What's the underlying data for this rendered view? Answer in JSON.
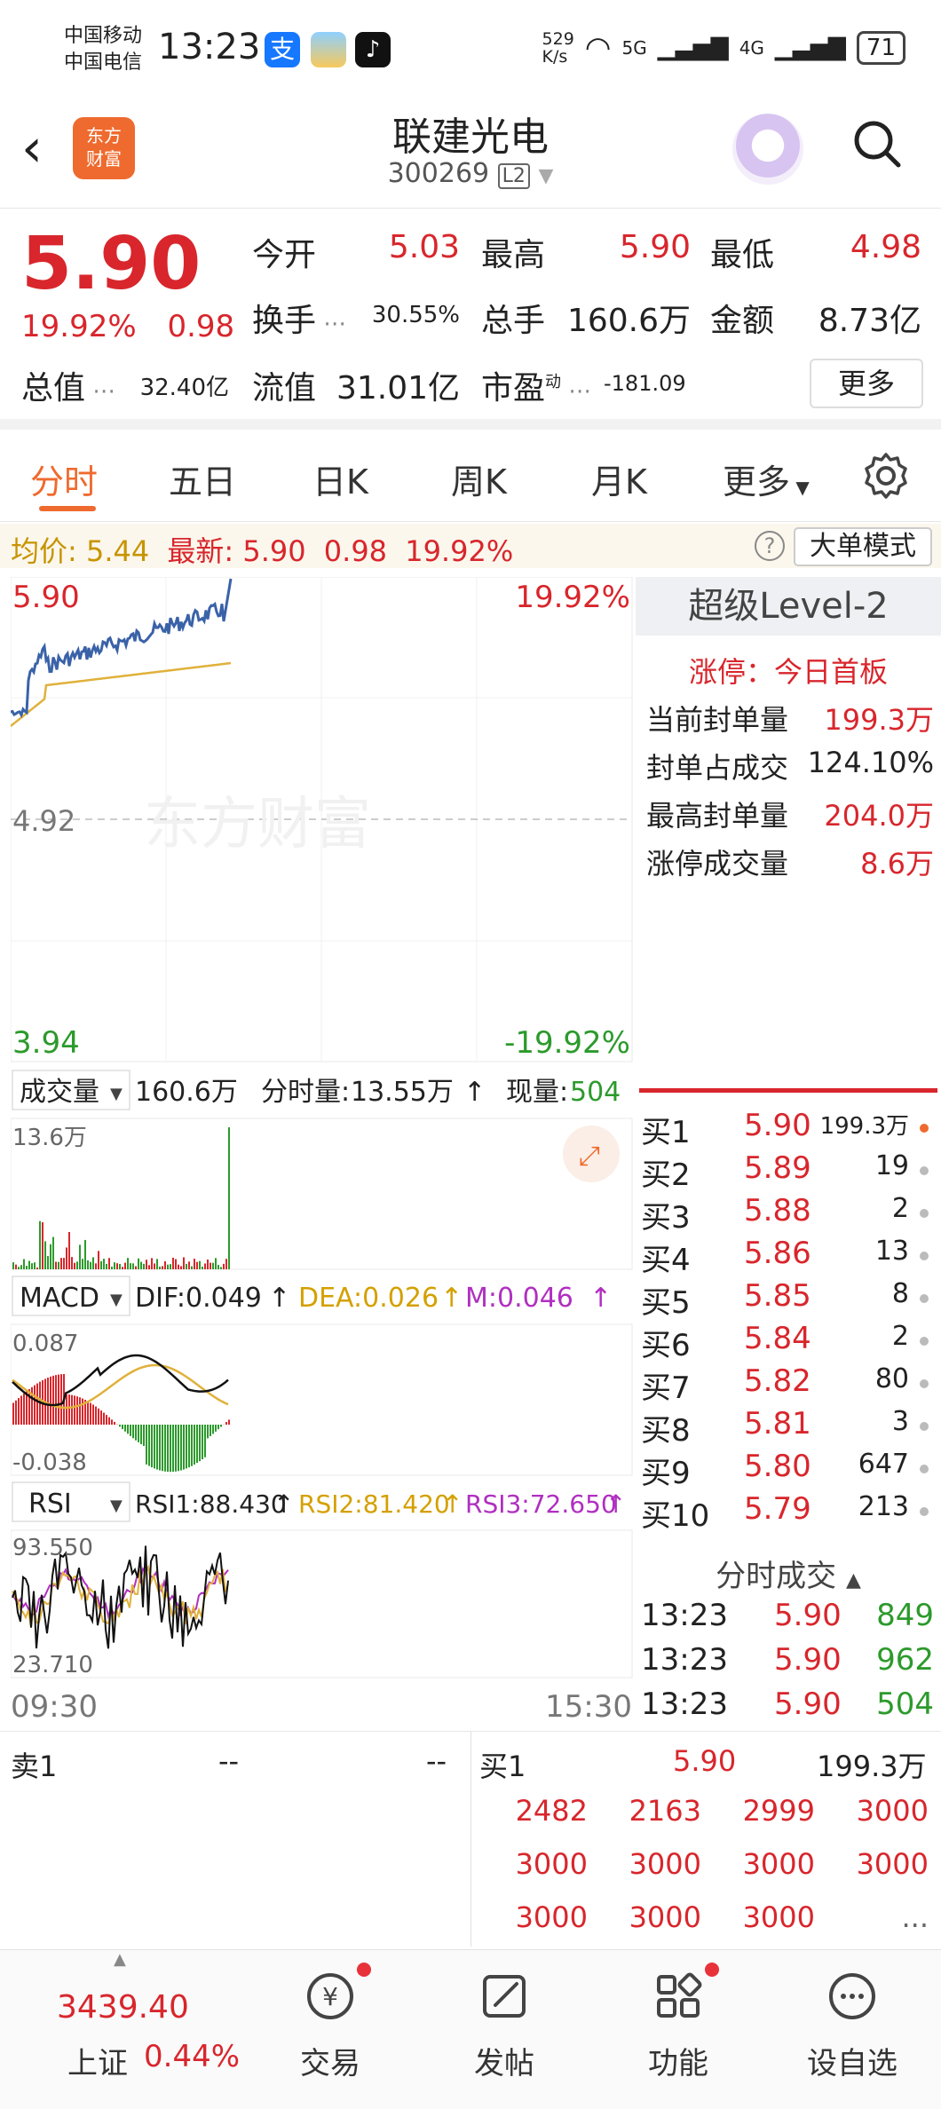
{
  "status_bar": {
    "carrier1": "中国移动",
    "carrier2": "中国电信",
    "time": "13:23",
    "net_speed": "529\nK/s",
    "signal1": "5G",
    "signal2": "4G",
    "battery": "71"
  },
  "header": {
    "logo_text": "东方\n财富",
    "stock_name": "联建光电",
    "stock_code": "300269",
    "level_badge": "L2"
  },
  "quote": {
    "price": "5.90",
    "change_pct": "19.92%",
    "change": "0.98",
    "fields": [
      {
        "label": "今开",
        "value": "5.03"
      },
      {
        "label": "最高",
        "value": "5.90"
      },
      {
        "label": "最低",
        "value": "4.98"
      },
      {
        "label": "换手",
        "value": "30.55%"
      },
      {
        "label": "总手",
        "value": "160.6万"
      },
      {
        "label": "金额",
        "value": "8.73亿"
      },
      {
        "label": "总值",
        "value": "32.40亿"
      },
      {
        "label": "流值",
        "value": "31.01亿"
      },
      {
        "label": "市盈",
        "value": "-181.09"
      }
    ],
    "pe_superscript": "动",
    "more_button": "更多"
  },
  "tabs": [
    "分时",
    "五日",
    "日K",
    "周K",
    "月K",
    "更多"
  ],
  "info_bar": {
    "avg_label": "均价:",
    "avg_value": "5.44",
    "latest_label": "最新:",
    "latest_value": "5.90",
    "latest_change": "0.98",
    "latest_pct": "19.92%",
    "help": "?",
    "mode_button": "大单模式"
  },
  "chart": {
    "top_price": "5.90",
    "top_pct": "19.92%",
    "mid_price": "4.92",
    "bottom_price": "3.94",
    "bottom_pct": "-19.92%",
    "watermark": "东方财富",
    "start_time": "09:30",
    "end_time": "15:30"
  },
  "volume_bar": {
    "selector": "成交量",
    "total": "160.6万",
    "minute_vol_label": "分时量:",
    "minute_vol": "13.55万",
    "now_label": "现量:",
    "now_value": "504",
    "axis_max": "13.6万"
  },
  "macd_bar": {
    "selector": "MACD",
    "dif": "DIF:0.049",
    "dea": "DEA:0.026",
    "m": "M:0.046",
    "axis_max": "0.087",
    "axis_min": "-0.038"
  },
  "rsi_bar": {
    "selector": "RSI",
    "rsi1": "RSI1:88.430",
    "rsi2": "RSI2:81.420",
    "rsi3": "RSI3:72.650",
    "axis_max": "93.550",
    "axis_min": "23.710"
  },
  "level2": {
    "title": "超级Level-2",
    "limit_label": "涨停：今日首板",
    "rows": [
      {
        "label": "当前封单量",
        "value": "199.3万"
      },
      {
        "label": "封单占成交",
        "value": "124.10%"
      },
      {
        "label": "最高封单量",
        "value": "204.0万"
      },
      {
        "label": "涨停成交量",
        "value": "8.6万"
      }
    ]
  },
  "order_book": [
    {
      "label": "买1",
      "price": "5.90",
      "volume": "199.3万"
    },
    {
      "label": "买2",
      "price": "5.89",
      "volume": "19"
    },
    {
      "label": "买3",
      "price": "5.88",
      "volume": "2"
    },
    {
      "label": "买4",
      "price": "5.86",
      "volume": "13"
    },
    {
      "label": "买5",
      "price": "5.85",
      "volume": "8"
    },
    {
      "label": "买6",
      "price": "5.84",
      "volume": "2"
    },
    {
      "label": "买7",
      "price": "5.82",
      "volume": "80"
    },
    {
      "label": "买8",
      "price": "5.81",
      "volume": "3"
    },
    {
      "label": "买9",
      "price": "5.80",
      "volume": "647"
    },
    {
      "label": "买10",
      "price": "5.79",
      "volume": "213"
    }
  ],
  "ticks_header": "分时成交",
  "ticks": [
    {
      "time": "13:23",
      "price": "5.90",
      "volume": "849"
    },
    {
      "time": "13:23",
      "price": "5.90",
      "volume": "962"
    },
    {
      "time": "13:23",
      "price": "5.90",
      "volume": "504"
    }
  ],
  "bottom_panel": {
    "sell_label": "卖1",
    "sell_price": "--",
    "sell_volume": "--",
    "buy_label": "买1",
    "buy_price": "5.90",
    "buy_volume": "199.3万",
    "queue": [
      "2482",
      "2163",
      "2999",
      "3000",
      "3000",
      "3000",
      "3000",
      "3000",
      "3000",
      "3000",
      "3000",
      "..."
    ]
  },
  "bottom_nav": {
    "index_value": "3439.40",
    "index_name": "上证",
    "index_pct": "0.44%",
    "items": [
      "交易",
      "发帖",
      "功能",
      "设自选"
    ]
  },
  "colors": {
    "up": "#d8262c",
    "down": "#2c9a2c",
    "accent": "#ef6a2e",
    "price_line": "#3a62a8",
    "avg_line": "#e0b13a"
  }
}
